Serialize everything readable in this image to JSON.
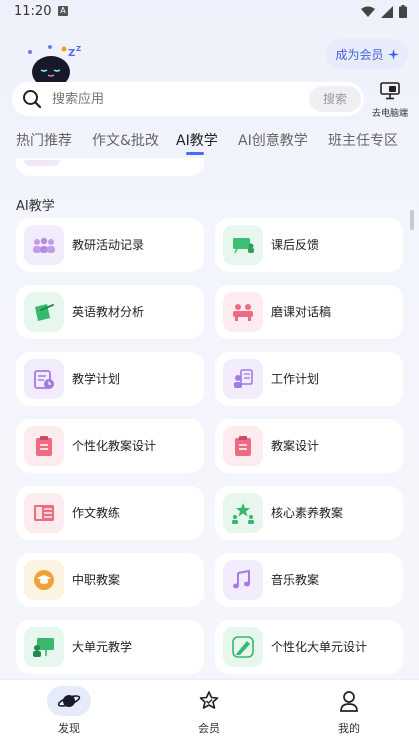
{
  "status_bar": {
    "time": "11:20",
    "sim_badge": "A"
  },
  "header": {
    "vip_label": "成为会员",
    "vip_icon": "sparkle-icon"
  },
  "search": {
    "placeholder": "搜索应用",
    "button_label": "搜索"
  },
  "background_action": {
    "label": "去电脑端",
    "icon": "monitor-icon"
  },
  "tabs": [
    {
      "label": "热门推荐",
      "active": false
    },
    {
      "label": "作文&批改",
      "active": false
    },
    {
      "label": "AI教学",
      "active": true
    },
    {
      "label": "AI创意教学",
      "active": false
    },
    {
      "label": "班主任专区",
      "active": false
    }
  ],
  "section": {
    "title": "AI教学"
  },
  "items": [
    {
      "label": "教研活动记录",
      "icon": "group-icon",
      "bg": "#f2ecfc",
      "fg": "#b78ae6"
    },
    {
      "label": "课后反馈",
      "icon": "classroom-icon",
      "bg": "#e8f7ee",
      "fg": "#3bbf74"
    },
    {
      "label": "英语教材分析",
      "icon": "book-pen-icon",
      "bg": "#e8f7ee",
      "fg": "#37b86d"
    },
    {
      "label": "磨课对话稿",
      "icon": "dialogue-icon",
      "bg": "#fdecef",
      "fg": "#ef6b82"
    },
    {
      "label": "教学计划",
      "icon": "plan-clock-icon",
      "bg": "#f2ecfc",
      "fg": "#a27be3"
    },
    {
      "label": "工作计划",
      "icon": "work-plan-icon",
      "bg": "#f2ecfc",
      "fg": "#a27be3"
    },
    {
      "label": "个性化教案设计",
      "icon": "clipboard-icon",
      "bg": "#fdecef",
      "fg": "#ef6b82"
    },
    {
      "label": "教案设计",
      "icon": "clipboard-icon",
      "bg": "#fdecef",
      "fg": "#ef6b82"
    },
    {
      "label": "作文教练",
      "icon": "essay-icon",
      "bg": "#fdecef",
      "fg": "#ef6b82"
    },
    {
      "label": "核心素养教案",
      "icon": "star-people-icon",
      "bg": "#e8f7ee",
      "fg": "#37b86d"
    },
    {
      "label": "中职教案",
      "icon": "graduation-icon",
      "bg": "#fdf3e3",
      "fg": "#f0a23a"
    },
    {
      "label": "音乐教案",
      "icon": "music-icon",
      "bg": "#f2ecfc",
      "fg": "#a27be3"
    },
    {
      "label": "大单元教学",
      "icon": "teacher-board-icon",
      "bg": "#e8f7ee",
      "fg": "#37b86d"
    },
    {
      "label": "个性化大单元设计",
      "icon": "pen-design-icon",
      "bg": "#e8f7ee",
      "fg": "#37b86d"
    }
  ],
  "bottom_nav": [
    {
      "label": "发现",
      "icon": "planet-icon",
      "active": true
    },
    {
      "label": "会员",
      "icon": "star-badge-icon",
      "active": false
    },
    {
      "label": "我的",
      "icon": "user-icon",
      "active": false
    }
  ],
  "colors": {
    "accent": "#4a6cf0",
    "vip_text": "#4a5ee0"
  }
}
